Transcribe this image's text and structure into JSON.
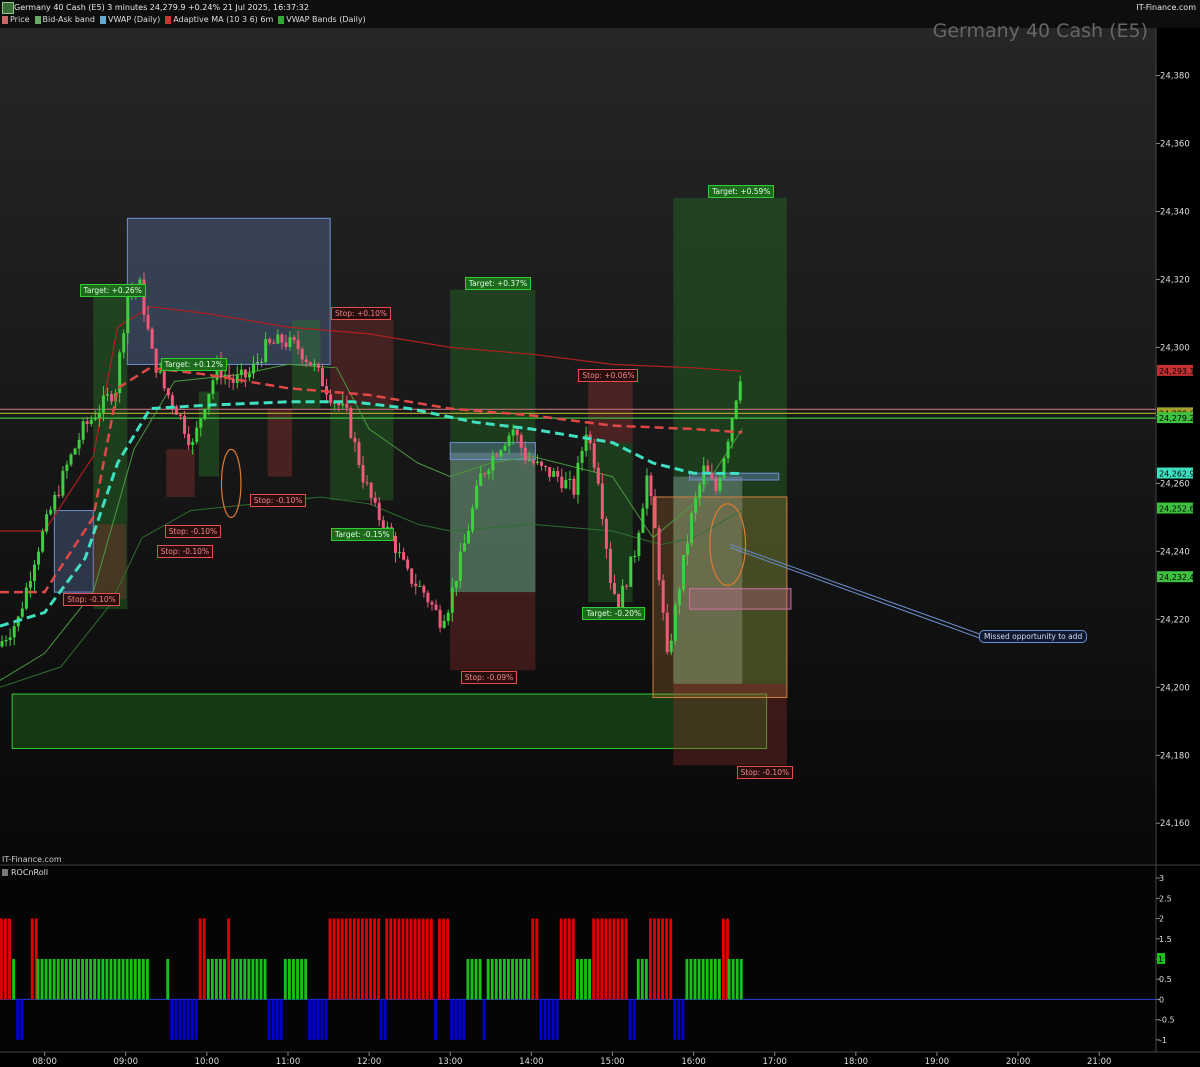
{
  "header": {
    "title": "Germany 40 Cash (E5) 3 minutes 24,279.9 +0.24% 21 Jul 2025, 16:37:32",
    "brand": "IT-Finance.com",
    "chart_title": "Germany 40 Cash (E5)",
    "watermark": "IT-Finance.com",
    "legend": [
      {
        "label": "Price",
        "color": "#cc6666"
      },
      {
        "label": "Bid-Ask band",
        "color": "#66aa66"
      },
      {
        "label": "VWAP (Daily)",
        "color": "#66aacc"
      },
      {
        "label": "Adaptive MA (10 3 6) 6m",
        "color": "#cc3333"
      },
      {
        "label": "VWAP Bands (Daily)",
        "color": "#33aa33"
      }
    ]
  },
  "colors": {
    "bull": "#3ecf3e",
    "bear": "#ef5a7a",
    "vwap": "#3fe0c0",
    "ama": "#e04040",
    "band": "#4a9a40"
  },
  "chart_data": [
    {
      "type": "candlestick",
      "title": "Germany 40 Cash (E5)",
      "x_ticks": [
        "08:00",
        "09:00",
        "10:00",
        "11:00",
        "12:00",
        "13:00",
        "14:00",
        "15:00",
        "16:00",
        "17:00",
        "18:00",
        "19:00",
        "20:00",
        "21:00"
      ],
      "y_ticks": [
        "24,160",
        "24,180",
        "24,200",
        "24,220",
        "24,240",
        "24,260",
        "24,280",
        "24,300",
        "24,320",
        "24,340",
        "24,360",
        "24,380"
      ],
      "ylim": [
        24148,
        24394
      ],
      "xlim_hours": [
        7.45,
        21.7
      ],
      "price_path": [
        [
          7.45,
          24212
        ],
        [
          7.7,
          24220
        ],
        [
          7.9,
          24238
        ],
        [
          8.1,
          24252
        ],
        [
          8.3,
          24265
        ],
        [
          8.5,
          24276
        ],
        [
          8.7,
          24282
        ],
        [
          8.9,
          24288
        ],
        [
          9.05,
          24316
        ],
        [
          9.2,
          24318
        ],
        [
          9.35,
          24298
        ],
        [
          9.5,
          24288
        ],
        [
          9.65,
          24282
        ],
        [
          9.85,
          24271
        ],
        [
          10.0,
          24284
        ],
        [
          10.15,
          24294
        ],
        [
          10.35,
          24290
        ],
        [
          10.55,
          24292
        ],
        [
          10.75,
          24300
        ],
        [
          10.95,
          24302
        ],
        [
          11.15,
          24300
        ],
        [
          11.35,
          24294
        ],
        [
          11.55,
          24286
        ],
        [
          11.75,
          24280
        ],
        [
          11.95,
          24262
        ],
        [
          12.1,
          24252
        ],
        [
          12.3,
          24244
        ],
        [
          12.5,
          24233
        ],
        [
          12.7,
          24228
        ],
        [
          12.9,
          24220
        ],
        [
          13.0,
          24224
        ],
        [
          13.2,
          24242
        ],
        [
          13.4,
          24262
        ],
        [
          13.6,
          24270
        ],
        [
          13.8,
          24276
        ],
        [
          13.95,
          24268
        ],
        [
          14.15,
          24264
        ],
        [
          14.35,
          24262
        ],
        [
          14.55,
          24258
        ],
        [
          14.7,
          24276
        ],
        [
          14.85,
          24262
        ],
        [
          15.0,
          24232
        ],
        [
          15.1,
          24224
        ],
        [
          15.3,
          24240
        ],
        [
          15.45,
          24262
        ],
        [
          15.55,
          24246
        ],
        [
          15.7,
          24208
        ],
        [
          15.85,
          24230
        ],
        [
          16.0,
          24250
        ],
        [
          16.15,
          24264
        ],
        [
          16.3,
          24258
        ],
        [
          16.45,
          24274
        ],
        [
          16.6,
          24292
        ]
      ],
      "vwap_path": [
        [
          7.45,
          24218
        ],
        [
          8.0,
          24222
        ],
        [
          8.5,
          24238
        ],
        [
          8.9,
          24266
        ],
        [
          9.3,
          24282
        ],
        [
          10.0,
          24283
        ],
        [
          11.0,
          24284
        ],
        [
          11.8,
          24284
        ],
        [
          12.5,
          24282
        ],
        [
          13.3,
          24278
        ],
        [
          14.0,
          24276
        ],
        [
          15.0,
          24272
        ],
        [
          15.5,
          24266
        ],
        [
          16.0,
          24263
        ],
        [
          16.6,
          24262.9
        ]
      ],
      "ama_path": [
        [
          7.45,
          24246
        ],
        [
          8.0,
          24246
        ],
        [
          8.6,
          24268
        ],
        [
          8.9,
          24306
        ],
        [
          9.3,
          24312
        ],
        [
          10.0,
          24310
        ],
        [
          11.0,
          24306
        ],
        [
          12.0,
          24304
        ],
        [
          13.0,
          24300
        ],
        [
          14.0,
          24298
        ],
        [
          15.0,
          24295
        ],
        [
          16.0,
          24294
        ],
        [
          16.6,
          24293
        ]
      ],
      "band_upper_path": [
        [
          7.45,
          24202
        ],
        [
          8.0,
          24210
        ],
        [
          8.6,
          24228
        ],
        [
          9.1,
          24270
        ],
        [
          9.6,
          24290
        ],
        [
          10.4,
          24292
        ],
        [
          11.0,
          24295
        ],
        [
          11.6,
          24294
        ],
        [
          12.0,
          24276
        ],
        [
          12.6,
          24266
        ],
        [
          13.0,
          24262
        ],
        [
          13.5,
          24266
        ],
        [
          14.0,
          24268
        ],
        [
          15.0,
          24262
        ],
        [
          15.5,
          24244
        ],
        [
          16.0,
          24254
        ],
        [
          16.6,
          24276
        ]
      ],
      "band_lower_path": [
        [
          7.45,
          24200
        ],
        [
          8.2,
          24206
        ],
        [
          8.8,
          24224
        ],
        [
          9.2,
          24244
        ],
        [
          9.8,
          24252
        ],
        [
          10.6,
          24254
        ],
        [
          11.4,
          24256
        ],
        [
          12.0,
          24254
        ],
        [
          12.6,
          24248
        ],
        [
          13.0,
          24246
        ],
        [
          14.0,
          24248
        ],
        [
          15.0,
          24246
        ],
        [
          15.6,
          24242
        ],
        [
          16.0,
          24244
        ],
        [
          16.6,
          24252
        ]
      ],
      "hlines": [
        {
          "y": 24280.6,
          "color": "#a4a030"
        },
        {
          "y": 24279.2,
          "color": "#40c040"
        },
        {
          "y": 24281.8,
          "color": "#c07070"
        }
      ],
      "zones": [
        {
          "x1": 7.6,
          "x2": 16.9,
          "y1": 24182,
          "y2": 24198,
          "fill": "rgba(30,110,30,0.45)",
          "stroke": "#3c3"
        },
        {
          "x1": 9.02,
          "x2": 11.52,
          "y1": 24295,
          "y2": 24338,
          "fill": "rgba(110,140,200,0.32)",
          "stroke": "#6f8fd0"
        },
        {
          "x1": 8.6,
          "x2": 9.02,
          "y1": 24223,
          "y2": 24316,
          "fill": "rgba(40,120,40,0.42)",
          "stroke": "none"
        },
        {
          "x1": 8.12,
          "x2": 8.6,
          "y1": 24228,
          "y2": 24252,
          "fill": "rgba(110,140,200,0.3)",
          "stroke": "#6f8fd0"
        },
        {
          "x1": 8.6,
          "x2": 9.0,
          "y1": 24226,
          "y2": 24248,
          "fill": "rgba(150,50,50,0.35)",
          "stroke": "none"
        },
        {
          "x1": 9.5,
          "x2": 9.85,
          "y1": 24256,
          "y2": 24270,
          "fill": "rgba(150,50,50,0.4)",
          "stroke": "none"
        },
        {
          "x1": 9.9,
          "x2": 10.15,
          "y1": 24262,
          "y2": 24287,
          "fill": "rgba(40,120,40,0.42)",
          "stroke": "none"
        },
        {
          "x1": 10.75,
          "x2": 11.05,
          "y1": 24262,
          "y2": 24282,
          "fill": "rgba(150,50,50,0.4)",
          "stroke": "none"
        },
        {
          "x1": 11.05,
          "x2": 11.4,
          "y1": 24282,
          "y2": 24308,
          "fill": "rgba(40,120,40,0.42)",
          "stroke": "none"
        },
        {
          "x1": 11.52,
          "x2": 12.3,
          "y1": 24283,
          "y2": 24308,
          "fill": "rgba(150,50,50,0.35)",
          "stroke": "none"
        },
        {
          "x1": 11.52,
          "x2": 12.3,
          "y1": 24255,
          "y2": 24283,
          "fill": "rgba(40,120,40,0.38)",
          "stroke": "none"
        },
        {
          "x1": 13.0,
          "x2": 14.05,
          "y1": 24228,
          "y2": 24317,
          "fill": "rgba(40,120,40,0.38)",
          "stroke": "none"
        },
        {
          "x1": 13.0,
          "x2": 14.05,
          "y1": 24228,
          "y2": 24269,
          "fill": "rgba(200,220,230,0.28)",
          "stroke": "none"
        },
        {
          "x1": 13.0,
          "x2": 14.05,
          "y1": 24205,
          "y2": 24228,
          "fill": "rgba(150,50,50,0.35)",
          "stroke": "none"
        },
        {
          "x1": 13.0,
          "x2": 14.05,
          "y1": 24267,
          "y2": 24272,
          "fill": "rgba(110,140,200,0.35)",
          "stroke": "#6f8fd0"
        },
        {
          "x1": 14.7,
          "x2": 15.25,
          "y1": 24272,
          "y2": 24290,
          "fill": "rgba(150,50,50,0.4)",
          "stroke": "none"
        },
        {
          "x1": 14.7,
          "x2": 15.25,
          "y1": 24225,
          "y2": 24272,
          "fill": "rgba(40,120,40,0.38)",
          "stroke": "none"
        },
        {
          "x1": 15.75,
          "x2": 17.15,
          "y1": 24201,
          "y2": 24344,
          "fill": "rgba(40,120,40,0.38)",
          "stroke": "none"
        },
        {
          "x1": 15.75,
          "x2": 16.6,
          "y1": 24201,
          "y2": 24262,
          "fill": "rgba(200,220,230,0.28)",
          "stroke": "none"
        },
        {
          "x1": 15.75,
          "x2": 17.15,
          "y1": 24177,
          "y2": 24201,
          "fill": "rgba(150,50,50,0.35)",
          "stroke": "none"
        },
        {
          "x1": 15.5,
          "x2": 17.15,
          "y1": 24197,
          "y2": 24256,
          "fill": "rgba(200,130,60,0.25)",
          "stroke": "#d08040"
        },
        {
          "x1": 15.95,
          "x2": 17.2,
          "y1": 24223,
          "y2": 24229,
          "fill": "rgba(200,100,150,0.3)",
          "stroke": "#d070a0"
        },
        {
          "x1": 15.95,
          "x2": 17.05,
          "y1": 24261,
          "y2": 24263,
          "fill": "rgba(110,140,200,0.4)",
          "stroke": "#6f8fd0"
        }
      ],
      "ellipses": [
        {
          "x": 10.3,
          "y": 24260,
          "rx": 0.12,
          "ry": 10,
          "color": "#e07a30"
        },
        {
          "x": 16.42,
          "y": 24242,
          "rx": 0.22,
          "ry": 12,
          "color": "#e07a30"
        }
      ],
      "targets": [
        {
          "label": "Target: +0.26%",
          "x": 8.8,
          "y": 24317
        },
        {
          "label": "Target: +0.12%",
          "x": 9.8,
          "y": 24295
        },
        {
          "label": "Target: +0.37%",
          "x": 13.55,
          "y": 24319
        },
        {
          "label": "Target: -0.15%",
          "x": 11.9,
          "y": 24245
        },
        {
          "label": "Target: -0.20%",
          "x": 15.0,
          "y": 24222
        },
        {
          "label": "Target: +0.59%",
          "x": 16.55,
          "y": 24346
        }
      ],
      "stops": [
        {
          "label": "Stop: -0.10%",
          "x": 8.6,
          "y": 24226
        },
        {
          "label": "Stop: -0.10%",
          "x": 9.85,
          "y": 24246
        },
        {
          "label": "Stop: -0.10%",
          "x": 9.75,
          "y": 24240
        },
        {
          "label": "Stop: -0.10%",
          "x": 10.9,
          "y": 24255
        },
        {
          "label": "Stop: +0.10%",
          "x": 11.9,
          "y": 24310
        },
        {
          "label": "Stop: -0.09%",
          "x": 13.5,
          "y": 24203
        },
        {
          "label": "Stop: +0.06%",
          "x": 14.95,
          "y": 24292
        },
        {
          "label": "Stop: -0.10%",
          "x": 16.9,
          "y": 24175
        }
      ],
      "price_labels": [
        {
          "text": "24,293.1",
          "y": 24293.1,
          "color": "#c03030"
        },
        {
          "text": "24,280.6",
          "y": 24280.6,
          "color": "#a4a030"
        },
        {
          "text": "24,279.2",
          "y": 24279.2,
          "color": "#40c040"
        },
        {
          "text": "24,262.9",
          "y": 24262.9,
          "color": "#3fe0c0"
        },
        {
          "text": "24,252.6",
          "y": 24252.6,
          "color": "#40c040"
        },
        {
          "text": "24,232.4",
          "y": 24232.4,
          "color": "#40c040"
        }
      ],
      "annotation": {
        "text": "Missed opportunity to add",
        "from_x": 16.45,
        "from_y": 24242
      }
    },
    {
      "type": "bar",
      "title": "ROCnRoll",
      "y_ticks": [
        "3",
        "2.5",
        "2",
        "1.5",
        "1",
        "0.5",
        "0",
        "-0.5",
        "-1"
      ],
      "ylim": [
        -1.3,
        3.2
      ],
      "current_value": "1",
      "color_map": {
        "2": "#e00000",
        "1": "#18c018",
        "-1": "#0000d0"
      },
      "segments": [
        {
          "from": 7.45,
          "to": 7.6,
          "value": 2
        },
        {
          "from": 7.6,
          "to": 7.65,
          "value": 1
        },
        {
          "from": 7.65,
          "to": 7.75,
          "value": -1
        },
        {
          "from": 7.83,
          "to": 7.9,
          "value": 2
        },
        {
          "from": 7.9,
          "to": 8.0,
          "value": 1
        },
        {
          "from": 8.0,
          "to": 9.3,
          "value": 1
        },
        {
          "from": 9.5,
          "to": 9.55,
          "value": 1
        },
        {
          "from": 9.55,
          "to": 9.9,
          "value": -1
        },
        {
          "from": 9.9,
          "to": 10.0,
          "value": 2
        },
        {
          "from": 10.0,
          "to": 10.25,
          "value": 1
        },
        {
          "from": 10.25,
          "to": 10.3,
          "value": 2
        },
        {
          "from": 10.3,
          "to": 10.75,
          "value": 1
        },
        {
          "from": 10.75,
          "to": 10.95,
          "value": -1
        },
        {
          "from": 10.95,
          "to": 11.25,
          "value": 1
        },
        {
          "from": 11.25,
          "to": 11.5,
          "value": -1
        },
        {
          "from": 11.5,
          "to": 12.13,
          "value": 2
        },
        {
          "from": 12.13,
          "to": 12.2,
          "value": -1
        },
        {
          "from": 12.2,
          "to": 12.8,
          "value": 2
        },
        {
          "from": 12.8,
          "to": 12.85,
          "value": -1
        },
        {
          "from": 12.85,
          "to": 13.0,
          "value": 2
        },
        {
          "from": 13.0,
          "to": 13.2,
          "value": -1
        },
        {
          "from": 13.2,
          "to": 13.4,
          "value": 1
        },
        {
          "from": 13.4,
          "to": 13.45,
          "value": -1
        },
        {
          "from": 13.45,
          "to": 14.0,
          "value": 1
        },
        {
          "from": 14.0,
          "to": 14.1,
          "value": 2
        },
        {
          "from": 14.1,
          "to": 14.35,
          "value": -1
        },
        {
          "from": 14.35,
          "to": 14.55,
          "value": 2
        },
        {
          "from": 14.55,
          "to": 14.75,
          "value": 1
        },
        {
          "from": 14.75,
          "to": 15.2,
          "value": 2
        },
        {
          "from": 15.2,
          "to": 15.3,
          "value": -1
        },
        {
          "from": 15.3,
          "to": 15.45,
          "value": 1
        },
        {
          "from": 15.45,
          "to": 15.75,
          "value": 2
        },
        {
          "from": 15.75,
          "to": 15.9,
          "value": -1
        },
        {
          "from": 15.9,
          "to": 16.35,
          "value": 1
        },
        {
          "from": 16.35,
          "to": 16.42,
          "value": 2
        },
        {
          "from": 16.42,
          "to": 16.6,
          "value": 1
        }
      ]
    }
  ]
}
